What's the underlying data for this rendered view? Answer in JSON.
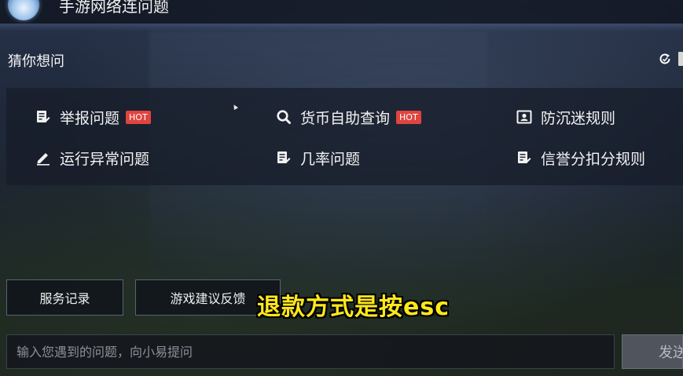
{
  "window": {
    "title": "手游网络连问题"
  },
  "section": {
    "title": "猜你想问",
    "refresh_icon": "refresh-icon"
  },
  "questions": [
    {
      "label": "举报问题",
      "icon": "report-doc-icon",
      "hot": "HOT"
    },
    {
      "label": "货币自助查询",
      "icon": "search-icon",
      "hot": "HOT"
    },
    {
      "label": "防沉迷规则",
      "icon": "id-card-icon",
      "hot": ""
    },
    {
      "label": "运行异常问题",
      "icon": "pencil-icon",
      "hot": ""
    },
    {
      "label": "几率问题",
      "icon": "doc-edit-icon",
      "hot": ""
    },
    {
      "label": "信誉分扣分规则",
      "icon": "doc-edit-icon",
      "hot": ""
    }
  ],
  "buttons": {
    "service_record": "服务记录",
    "game_feedback": "游戏建议反馈"
  },
  "subtitle": "退款方式是按esc",
  "input": {
    "placeholder": "输入您遇到的问题，向小易提问",
    "value": ""
  },
  "send": {
    "label": "发送"
  },
  "colors": {
    "hot_badge": "#e0443e",
    "subtitle": "#ffe81a",
    "panel_bg": "#161c28"
  }
}
